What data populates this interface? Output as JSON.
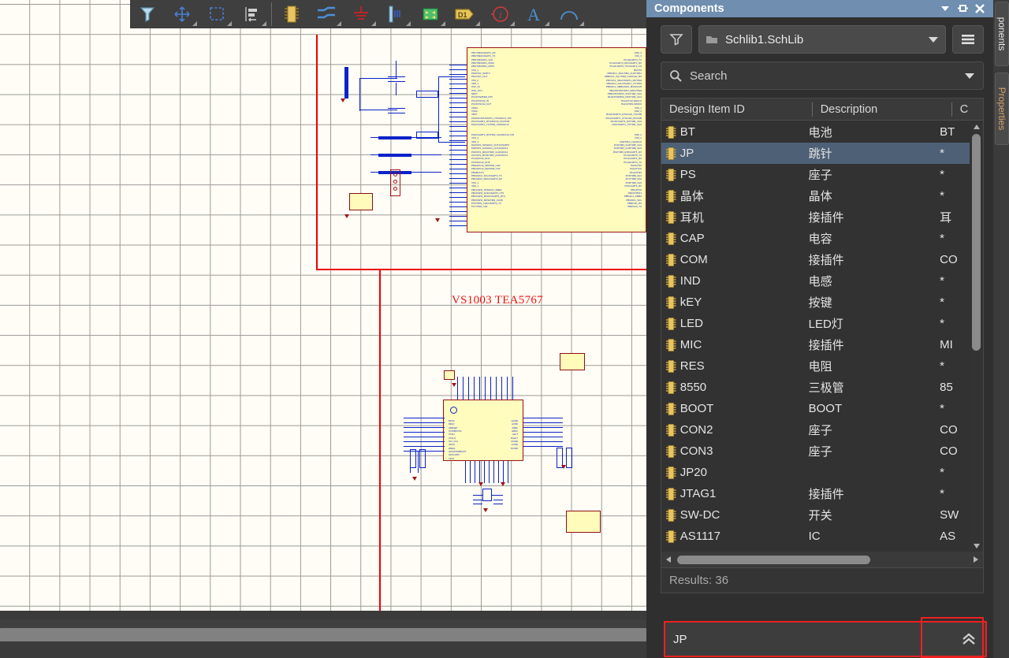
{
  "toolbar": {
    "items": [
      {
        "name": "filter-tool",
        "icon": "funnel"
      },
      {
        "name": "move-tool",
        "icon": "move-arrows"
      },
      {
        "name": "select-area-tool",
        "icon": "dashed-rect"
      },
      {
        "name": "align-tool",
        "icon": "align"
      },
      {
        "name": "place-part-tool",
        "icon": "chip"
      },
      {
        "name": "place-wire-tool",
        "icon": "wire"
      },
      {
        "name": "place-gnd-tool",
        "icon": "ground"
      },
      {
        "name": "place-bus-tool",
        "icon": "bus"
      },
      {
        "name": "place-sheet-symbol-tool",
        "icon": "sheet"
      },
      {
        "name": "place-port-tool",
        "icon": "port-d1"
      },
      {
        "name": "place-no-erc-tool",
        "icon": "info-circle"
      },
      {
        "name": "place-text-tool",
        "icon": "text-a"
      },
      {
        "name": "place-arc-tool",
        "icon": "arc"
      }
    ]
  },
  "panel": {
    "title": "Components",
    "title_buttons": [
      "chevron-down",
      "pin",
      "close"
    ],
    "library": {
      "value": "Schlib1.SchLib"
    },
    "search": {
      "placeholder": "Search"
    },
    "table": {
      "columns": [
        "Design Item ID",
        "Description",
        "C"
      ],
      "rows": [
        {
          "id": "BT",
          "desc": "电池",
          "c": "BT"
        },
        {
          "id": "JP",
          "desc": "跳针",
          "c": "*"
        },
        {
          "id": "PS",
          "desc": "座子",
          "c": "*"
        },
        {
          "id": "晶体",
          "desc": "晶体",
          "c": "*"
        },
        {
          "id": "耳机",
          "desc": "接插件",
          "c": "耳"
        },
        {
          "id": "CAP",
          "desc": "电容",
          "c": "*"
        },
        {
          "id": "COM",
          "desc": "接插件",
          "c": "CO"
        },
        {
          "id": "IND",
          "desc": "电感",
          "c": "*"
        },
        {
          "id": "kEY",
          "desc": "按键",
          "c": "*"
        },
        {
          "id": "LED",
          "desc": "LED灯",
          "c": "*"
        },
        {
          "id": "MIC",
          "desc": "接插件",
          "c": "MI"
        },
        {
          "id": "RES",
          "desc": "电阻",
          "c": "*"
        },
        {
          "id": "8550",
          "desc": "三极管",
          "c": "85"
        },
        {
          "id": "BOOT",
          "desc": "BOOT",
          "c": "*"
        },
        {
          "id": "CON2",
          "desc": "座子",
          "c": "CO"
        },
        {
          "id": "CON3",
          "desc": "座子",
          "c": "CO"
        },
        {
          "id": "JP20",
          "desc": "",
          "c": "*"
        },
        {
          "id": "JTAG1",
          "desc": "接插件",
          "c": "*"
        },
        {
          "id": "SW-DC",
          "desc": "开关",
          "c": "SW"
        },
        {
          "id": "AS1117",
          "desc": "IC",
          "c": "AS"
        },
        {
          "id": "",
          "desc": "",
          "c": ""
        }
      ],
      "selected_index": 1
    },
    "results": "Results: 36",
    "place_field": {
      "value": "JP",
      "button_icon": "double-chevron-up"
    }
  },
  "side_tabs": [
    {
      "label": "ponents",
      "active": true
    },
    {
      "label": "Properties",
      "active": false
    }
  ],
  "schematic": {
    "annotation_text": "VS1003 TEA5767",
    "annotation_color": "#ee1111"
  }
}
